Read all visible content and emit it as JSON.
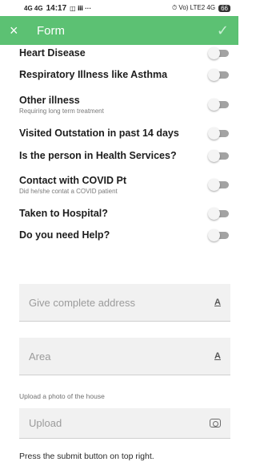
{
  "status_bar": {
    "left": "14:17",
    "signal": "4G 4G",
    "icons": "◫ ⅲ ···",
    "right": "⏱ Vo) LTE2 4G",
    "battery": "66"
  },
  "app_bar": {
    "close_icon": "×",
    "title": "Form",
    "submit_icon": "✓",
    "color": "#5cc173"
  },
  "questions": [
    {
      "label": "Heart Disease",
      "sub": ""
    },
    {
      "label": "Respiratory Illness like Asthma",
      "sub": ""
    },
    {
      "label": "Other illness",
      "sub": "Requiring long term treatment"
    },
    {
      "label": "Visited Outstation in past 14 days",
      "sub": ""
    },
    {
      "label": "Is the person in Health Services?",
      "sub": ""
    },
    {
      "label": "Contact with COVID Pt",
      "sub": "Did he/she contat a COVID patient"
    },
    {
      "label": "Taken to Hospital?",
      "sub": ""
    },
    {
      "label": "Do you need Help?",
      "sub": ""
    }
  ],
  "fields": {
    "address_placeholder": "Give complete address",
    "area_placeholder": "Area",
    "upload_label": "Upload a photo of the house",
    "upload_placeholder": "Upload",
    "text_icon": "A"
  },
  "footer": {
    "text": "Press the submit button on top right."
  }
}
